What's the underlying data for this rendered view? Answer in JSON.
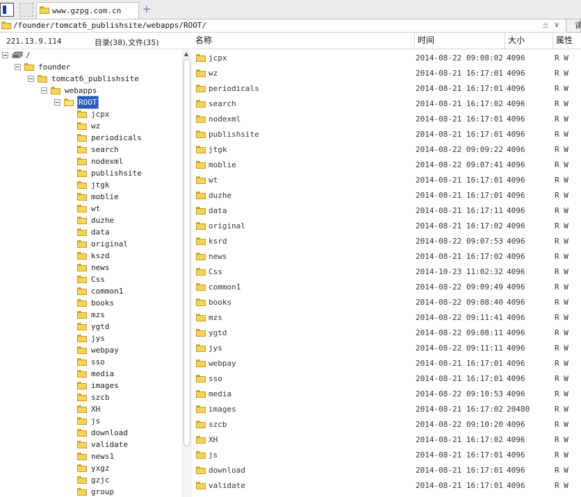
{
  "tab": {
    "title": "www.gzpg.com.cn",
    "add_label": "+"
  },
  "path": {
    "value": "/founder/tomcat6_publishsite/webapps/ROOT/",
    "pin": "±",
    "dropdown": "∨",
    "go_label": "读取"
  },
  "left": {
    "ip": "221.13.9.114",
    "counts": "目录(38),文件(35)"
  },
  "tree": {
    "root_label": "/",
    "ancestors": [
      {
        "label": "founder"
      },
      {
        "label": "tomcat6_publishsite"
      },
      {
        "label": "webapps"
      },
      {
        "label": "ROOT"
      }
    ],
    "children": [
      "jcpx",
      "wz",
      "periodicals",
      "search",
      "nodexml",
      "publishsite",
      "jtgk",
      "moblie",
      "wt",
      "duzhe",
      "data",
      "original",
      "kszd",
      "news",
      "Css",
      "common1",
      "books",
      "mzs",
      "ygtd",
      "jys",
      "webpay",
      "sso",
      "media",
      "images",
      "szcb",
      "XH",
      "js",
      "download",
      "validate",
      "news1",
      "yxgz",
      "gzjc",
      "group"
    ]
  },
  "columns": {
    "name": "名称",
    "time": "时间",
    "size": "大小",
    "attr": "属性"
  },
  "files": [
    {
      "name": "jcpx",
      "time": "2014-08-22 09:08:02",
      "size": "4096",
      "attr": "R W"
    },
    {
      "name": "wz",
      "time": "2014-08-21 16:17:01",
      "size": "4096",
      "attr": "R W"
    },
    {
      "name": "periodicals",
      "time": "2014-08-21 16:17:01",
      "size": "4096",
      "attr": "R W"
    },
    {
      "name": "search",
      "time": "2014-08-21 16:17:02",
      "size": "4096",
      "attr": "R W"
    },
    {
      "name": "nodexml",
      "time": "2014-08-21 16:17:01",
      "size": "4096",
      "attr": "R W"
    },
    {
      "name": "publishsite",
      "time": "2014-08-21 16:17:01",
      "size": "4096",
      "attr": "R W"
    },
    {
      "name": "jtgk",
      "time": "2014-08-22 09:09:22",
      "size": "4096",
      "attr": "R W"
    },
    {
      "name": "moblie",
      "time": "2014-08-22 09:07:41",
      "size": "4096",
      "attr": "R W"
    },
    {
      "name": "wt",
      "time": "2014-08-21 16:17:01",
      "size": "4096",
      "attr": "R W"
    },
    {
      "name": "duzhe",
      "time": "2014-08-21 16:17:01",
      "size": "4096",
      "attr": "R W"
    },
    {
      "name": "data",
      "time": "2014-08-21 16:17:11",
      "size": "4096",
      "attr": "R W"
    },
    {
      "name": "original",
      "time": "2014-08-21 16:17:02",
      "size": "4096",
      "attr": "R W"
    },
    {
      "name": "ksrd",
      "time": "2014-08-22 09:07:53",
      "size": "4096",
      "attr": "R W"
    },
    {
      "name": "news",
      "time": "2014-08-21 16:17:02",
      "size": "4096",
      "attr": "R W"
    },
    {
      "name": "Css",
      "time": "2014-10-23 11:02:32",
      "size": "4096",
      "attr": "R W"
    },
    {
      "name": "common1",
      "time": "2014-08-22 09:09:49",
      "size": "4096",
      "attr": "R W"
    },
    {
      "name": "books",
      "time": "2014-08-22 09:08:40",
      "size": "4096",
      "attr": "R W"
    },
    {
      "name": "mzs",
      "time": "2014-08-22 09:11:41",
      "size": "4096",
      "attr": "R W"
    },
    {
      "name": "ygtd",
      "time": "2014-08-22 09:08:11",
      "size": "4096",
      "attr": "R W"
    },
    {
      "name": "jys",
      "time": "2014-08-22 09:11:11",
      "size": "4096",
      "attr": "R W"
    },
    {
      "name": "webpay",
      "time": "2014-08-21 16:17:01",
      "size": "4096",
      "attr": "R W"
    },
    {
      "name": "sso",
      "time": "2014-08-21 16:17:01",
      "size": "4096",
      "attr": "R W"
    },
    {
      "name": "media",
      "time": "2014-08-22 09:10:53",
      "size": "4096",
      "attr": "R W"
    },
    {
      "name": "images",
      "time": "2014-08-21 16:17:02",
      "size": "20480",
      "attr": "R W"
    },
    {
      "name": "szcb",
      "time": "2014-08-22 09:10:20",
      "size": "4096",
      "attr": "R W"
    },
    {
      "name": "XH",
      "time": "2014-08-21 16:17:02",
      "size": "4096",
      "attr": "R W"
    },
    {
      "name": "js",
      "time": "2014-08-21 16:17:01",
      "size": "4096",
      "attr": "R W"
    },
    {
      "name": "download",
      "time": "2014-08-21 16:17:01",
      "size": "4096",
      "attr": "R W"
    },
    {
      "name": "validate",
      "time": "2014-08-21 16:17:01",
      "size": "4096",
      "attr": "R W"
    }
  ],
  "colors": {
    "folder": "#f6d45a",
    "selection": "#2a5bb8"
  }
}
